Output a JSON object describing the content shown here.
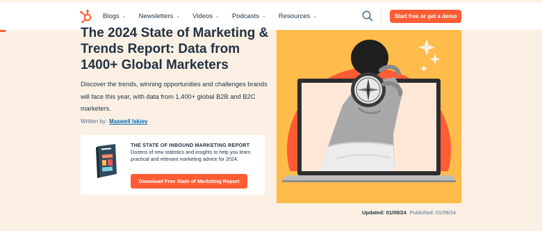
{
  "nav": {
    "logo_icon": "hubspot-sprocket-icon",
    "items": [
      {
        "label": "Blogs"
      },
      {
        "label": "Newsletters"
      },
      {
        "label": "Videos"
      },
      {
        "label": "Podcasts"
      },
      {
        "label": "Resources"
      }
    ],
    "search_icon": "search-icon",
    "cta_label": "Start free or get a demo"
  },
  "article": {
    "title": "The 2024 State of Marketing & Trends Report: Data from 1400+ Global Marketers",
    "description": "Discover the trends, winning opportunities and challenges brands will face this year, with data from 1,400+ global B2B and B2C marketers.",
    "byline_prefix": "Written by:",
    "author": "Maxwell Iskiev"
  },
  "promo": {
    "title": "THE STATE OF INBOUND MARKETING REPORT",
    "text": "Dozens of new statistics and insights to help you learn practical and relevant marketing advice for 2024.",
    "button_label": "Download Free State of Marketing Report"
  },
  "meta": {
    "updated_label": "Updated: 01/09/24",
    "published_label": "Published: 01/09/24"
  },
  "colors": {
    "accent": "#ff5c35",
    "background": "#fcf0e4",
    "text": "#213343",
    "link": "#0068b1",
    "hero_bg": "#ffbc4b"
  }
}
